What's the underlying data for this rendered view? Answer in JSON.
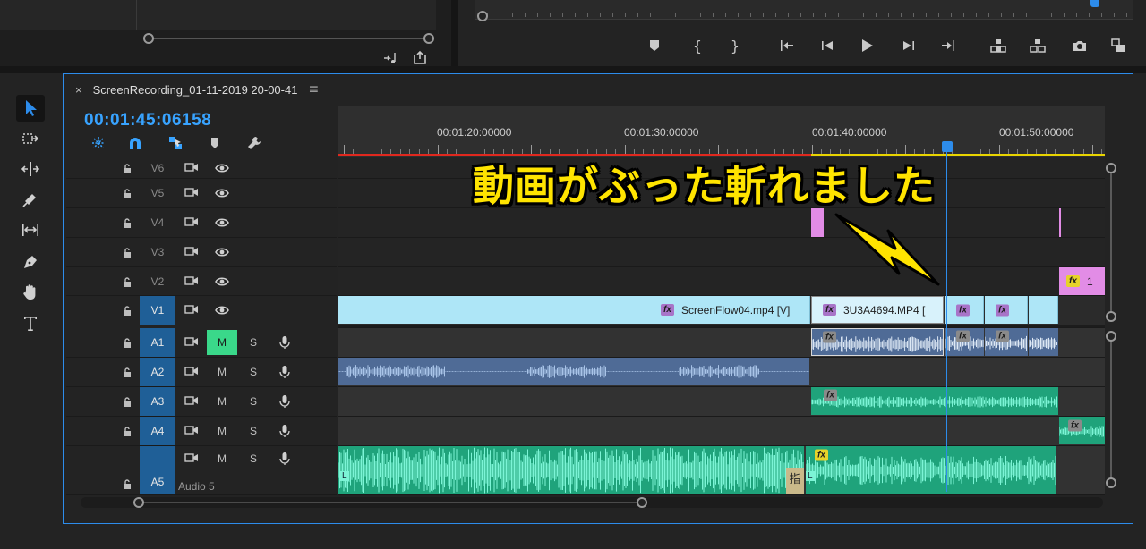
{
  "colors": {
    "accent": "#2d8ceb",
    "timecode": "#38a3ff",
    "video_clip": "#aee6f7",
    "audio_clip_blue": "#4f6b96",
    "audio_clip_teal": "#1fa37b",
    "adjustment_clip": "#e28ce6",
    "annotation_text": "#ffe400",
    "in_out_red": "#e0281e",
    "in_out_yellow": "#e8d400",
    "mute_on": "#3ad88a",
    "track_target": "#1f5f97"
  },
  "program_monitor": {
    "transport_icons": [
      "marker-icon",
      "mark-in-icon",
      "mark-out-icon",
      "go-to-in-icon",
      "step-back-icon",
      "play-icon",
      "step-forward-icon",
      "go-to-out-icon",
      "lift-icon",
      "extract-icon",
      "export-frame-icon",
      "compare-icon"
    ]
  },
  "tools": [
    "selection-tool-icon",
    "track-select-tool-icon",
    "ripple-edit-tool-icon",
    "razor-tool-icon",
    "slip-tool-icon",
    "pen-tool-icon",
    "hand-tool-icon",
    "type-tool-icon"
  ],
  "timeline": {
    "close_glyph": "×",
    "sequence_name": "ScreenRecording_01-11-2019 20-00-41",
    "menu_glyph": "≡",
    "timecode": "00:01:45:06158",
    "ruler_labels": [
      "00:01:20:00000",
      "00:01:30:00000",
      "00:01:40:00000",
      "00:01:50:00000"
    ],
    "video_tracks": [
      {
        "name": "V6"
      },
      {
        "name": "V5"
      },
      {
        "name": "V4"
      },
      {
        "name": "V3"
      },
      {
        "name": "V2"
      },
      {
        "name": "V1",
        "targeted": true
      }
    ],
    "audio_tracks": [
      {
        "name": "A1",
        "m": "M",
        "s": "S",
        "mute_on": true
      },
      {
        "name": "A2",
        "m": "M",
        "s": "S"
      },
      {
        "name": "A3",
        "m": "M",
        "s": "S"
      },
      {
        "name": "A4",
        "m": "M",
        "s": "S"
      },
      {
        "name": "A5",
        "m": "M",
        "s": "S",
        "label": "Audio 5"
      }
    ],
    "clips": {
      "v1_clip1": "ScreenFlow04.mp4 [V]",
      "v1_clip2": "3U3A4694.MP4 [",
      "v2_clip": "1",
      "fx_label": "fx",
      "a5_marker": "指",
      "channel_l": "L"
    }
  },
  "annotation": "動画がぶった斬れました"
}
